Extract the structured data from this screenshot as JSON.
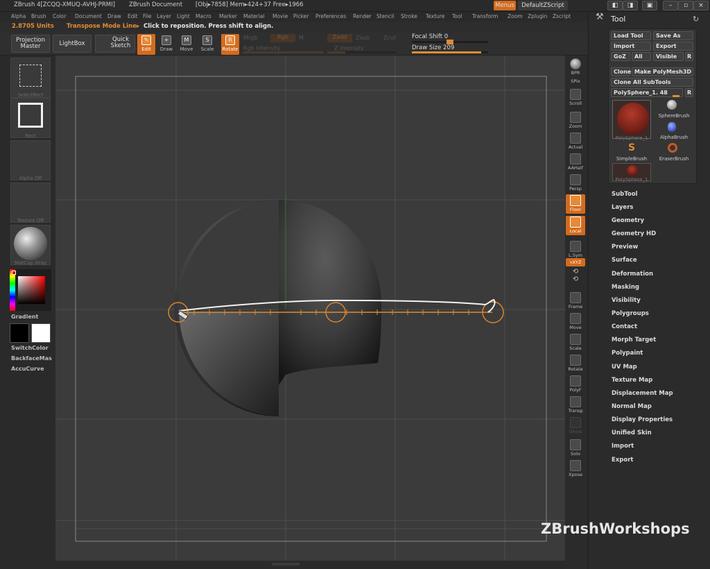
{
  "app": {
    "title": "ZBrush 4[ZCQQ-XMUQ-AVHJ-PRMI]",
    "document": "ZBrush Document",
    "obj_info": "[Obj▸7858] Mem▸424+37 Free▸1966",
    "menus_button": "Menus",
    "script_button": "DefaultZScript"
  },
  "menubar": {
    "items": [
      "Alpha",
      "Brush",
      "Color",
      "Document",
      "Draw",
      "Edit",
      "File",
      "Layer",
      "Light",
      "Macro",
      "Marker",
      "Material",
      "Movie",
      "Picker",
      "Preferences",
      "Render",
      "Stencil",
      "Stroke",
      "Texture",
      "Tool",
      "Transform",
      "Zoom",
      "Zplugin",
      "Zscript"
    ]
  },
  "status": {
    "units": "2.8705 Units",
    "mode": "Transpose Mode Line▸",
    "hint": "Click to reposition. Press shift to align."
  },
  "toolbar": {
    "projection_master": "Projection Master",
    "lightbox": "LightBox",
    "quick_sketch": "Quick Sketch",
    "edit": "Edit",
    "draw": "Draw",
    "move": "Move",
    "scale": "Scale",
    "rotate": "Rotate",
    "mrgb": "Mrgb",
    "rgb": "Rgb",
    "m": "M",
    "zadd": "Zadd",
    "zsub": "Zsub",
    "zcut": "Zcut",
    "rgb_intensity": "Rgb Intensity",
    "z_intensity": "Z Intensity",
    "focal_shift_label": "Focal Shift 0",
    "draw_size_label": "Draw Size 209",
    "focal_shift": 0,
    "draw_size": 209
  },
  "left_tray": {
    "select_rect": "SelectRect",
    "rect": "Rect",
    "alpha_off": "Alpha  Off",
    "texture_off": "Texture  Off",
    "matcap": "MatCap  Gray",
    "gradient": "Gradient",
    "switchcolor": "SwitchColor",
    "backface": "BackfaceMas",
    "accucurve": "AccuCurve"
  },
  "right_shelf": {
    "bpr": "BPR",
    "spix": "SPix",
    "scroll": "Scroll",
    "zoom": "Zoom",
    "actual": "Actual",
    "aahalf": "AAHalf",
    "persp": "Persp",
    "floor": "Floor",
    "local": "Local",
    "lsym": "L.Sym",
    "xyz": "«XYZ",
    "frame": "Frame",
    "move": "Move",
    "scale": "Scale",
    "rotate": "Rotate",
    "polyf": "PolyF",
    "transp": "Transp",
    "ghost": "Ghost",
    "solo": "Solo",
    "xpose": "Xpose"
  },
  "tool_panel": {
    "title": "Tool",
    "load_tool": "Load Tool",
    "save_as": "Save As",
    "import": "Import",
    "export": "Export",
    "goz": "GoZ",
    "all": "All",
    "visible": "Visible",
    "r": "R",
    "clone": "Clone",
    "make_polymesh": "Make PolyMesh3D",
    "clone_all": "Clone  All SubTools",
    "current_tool": "PolySphere_1. 48",
    "thumbs": {
      "polysphere_big": "PolySphere_1",
      "sphere_brush": "SphereBrush",
      "alpha_brush": "AlphaBrush",
      "simple_brush": "SimpleBrush",
      "eraser_brush": "EraserBrush",
      "polysphere_small": "PolySphere_1"
    },
    "sections": [
      "SubTool",
      "Layers",
      "Geometry",
      "Geometry HD",
      "Preview",
      "Surface",
      "Deformation",
      "Masking",
      "Visibility",
      "Polygroups",
      "Contact",
      "Morph Target",
      "Polypaint",
      "UV Map",
      "Texture Map",
      "Displacement Map",
      "Normal Map",
      "Display Properties",
      "Unified Skin",
      "Import",
      "Export"
    ]
  },
  "watermark": "ZBrushWorkshops",
  "colors": {
    "accent": "#d36b1e",
    "transpose_line": "#e08b33",
    "panel": "#2b2b2b"
  }
}
